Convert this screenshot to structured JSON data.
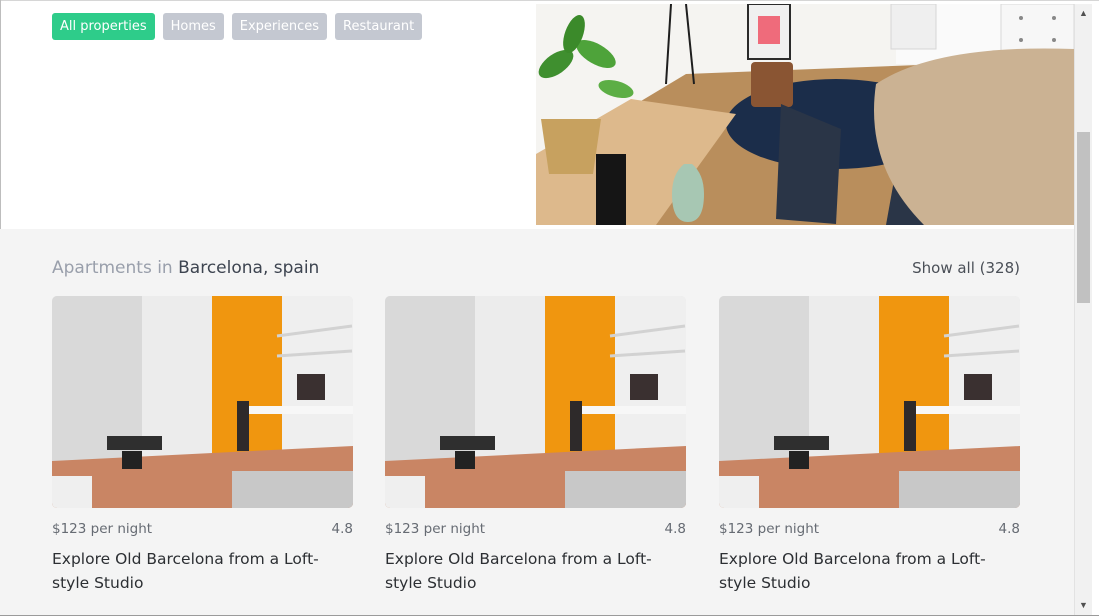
{
  "filters": [
    {
      "label": "All properties",
      "active": true
    },
    {
      "label": "Homes",
      "active": false
    },
    {
      "label": "Experiences",
      "active": false
    },
    {
      "label": "Restaurant",
      "active": false
    }
  ],
  "section": {
    "prefix": "Apartments in",
    "city": "Barcelona, spain",
    "show_all": "Show all (328)"
  },
  "listings": [
    {
      "price": "$123 per night",
      "rating": "4.8",
      "title": "Explore Old Barcelona from a Loft-style Studio"
    },
    {
      "price": "$123 per night",
      "rating": "4.8",
      "title": "Explore Old Barcelona from a Loft-style Studio"
    },
    {
      "price": "$123 per night",
      "rating": "4.8",
      "title": "Explore Old Barcelona from a Loft-style Studio"
    }
  ],
  "scrollbar": {
    "up_icon": "arrow-up-icon",
    "down_icon": "arrow-down-icon"
  }
}
